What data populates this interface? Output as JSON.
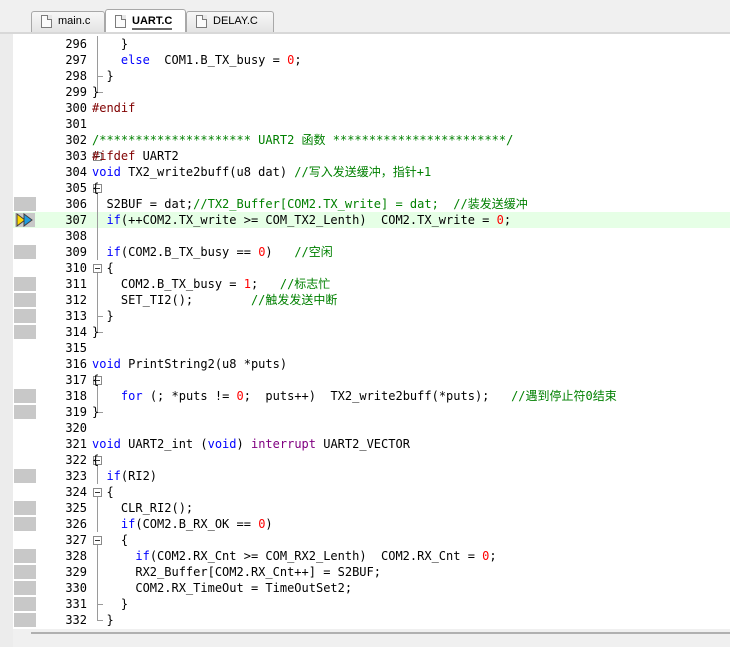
{
  "tabs": [
    {
      "label": "main.c",
      "active": false
    },
    {
      "label": "UART.C",
      "active": true
    },
    {
      "label": "DELAY.C",
      "active": false
    }
  ],
  "editor": {
    "lines": [
      {
        "num": "296",
        "code": [
          {
            "t": "    }"
          }
        ]
      },
      {
        "num": "297",
        "code": [
          {
            "t": "    "
          },
          {
            "t": "else",
            "c": "kw"
          },
          {
            "t": "  COM1.B_TX_busy = "
          },
          {
            "t": "0",
            "c": "num"
          },
          {
            "t": ";"
          }
        ]
      },
      {
        "num": "298",
        "code": [
          {
            "t": "  }"
          }
        ]
      },
      {
        "num": "299",
        "code": [
          {
            "t": "}"
          }
        ]
      },
      {
        "num": "300",
        "code": [
          {
            "t": "#endif",
            "c": "pp"
          }
        ]
      },
      {
        "num": "301",
        "code": []
      },
      {
        "num": "302",
        "code": [
          {
            "t": "/********************* UART2 函数 ************************/",
            "c": "cm"
          }
        ]
      },
      {
        "num": "303",
        "code": [
          {
            "t": "#ifdef",
            "c": "pp"
          },
          {
            "t": " UART2"
          }
        ]
      },
      {
        "num": "304",
        "code": [
          {
            "t": "void",
            "c": "kw"
          },
          {
            "t": " TX2_write2buff(u8 dat) "
          },
          {
            "t": "//写入发送缓冲，指针+1",
            "c": "cm"
          }
        ]
      },
      {
        "num": "305",
        "code": [
          {
            "t": "{"
          }
        ]
      },
      {
        "num": "306",
        "code": [
          {
            "t": "  S2BUF = dat;"
          },
          {
            "t": "//TX2_Buffer[COM2.TX_write] = dat;  //装发送缓冲",
            "c": "cm"
          }
        ]
      },
      {
        "num": "307",
        "code": [
          {
            "t": "  "
          },
          {
            "t": "if",
            "c": "kw"
          },
          {
            "t": "(++COM2.TX_write >= COM_TX2_Lenth)  COM2.TX_write = "
          },
          {
            "t": "0",
            "c": "num"
          },
          {
            "t": ";"
          }
        ]
      },
      {
        "num": "308",
        "code": []
      },
      {
        "num": "309",
        "code": [
          {
            "t": "  "
          },
          {
            "t": "if",
            "c": "kw"
          },
          {
            "t": "(COM2.B_TX_busy == "
          },
          {
            "t": "0",
            "c": "num"
          },
          {
            "t": ")   "
          },
          {
            "t": "//空闲",
            "c": "cm"
          }
        ]
      },
      {
        "num": "310",
        "code": [
          {
            "t": "  {"
          }
        ]
      },
      {
        "num": "311",
        "code": [
          {
            "t": "    COM2.B_TX_busy = "
          },
          {
            "t": "1",
            "c": "num"
          },
          {
            "t": ";   "
          },
          {
            "t": "//标志忙",
            "c": "cm"
          }
        ]
      },
      {
        "num": "312",
        "code": [
          {
            "t": "    SET_TI2();        "
          },
          {
            "t": "//触发发送中断",
            "c": "cm"
          }
        ]
      },
      {
        "num": "313",
        "code": [
          {
            "t": "  }"
          }
        ]
      },
      {
        "num": "314",
        "code": [
          {
            "t": "}"
          }
        ]
      },
      {
        "num": "315",
        "code": []
      },
      {
        "num": "316",
        "code": [
          {
            "t": "void",
            "c": "kw"
          },
          {
            "t": " PrintString2(u8 *puts)"
          }
        ]
      },
      {
        "num": "317",
        "code": [
          {
            "t": "{"
          }
        ]
      },
      {
        "num": "318",
        "code": [
          {
            "t": "    "
          },
          {
            "t": "for",
            "c": "kw"
          },
          {
            "t": " (; *puts != "
          },
          {
            "t": "0",
            "c": "num"
          },
          {
            "t": ";  puts++)  TX2_write2buff(*puts);   "
          },
          {
            "t": "//遇到停止符0结束",
            "c": "cm"
          }
        ]
      },
      {
        "num": "319",
        "code": [
          {
            "t": "}"
          }
        ]
      },
      {
        "num": "320",
        "code": []
      },
      {
        "num": "321",
        "code": [
          {
            "t": "void",
            "c": "kw"
          },
          {
            "t": " UART2_int ("
          },
          {
            "t": "void",
            "c": "kw"
          },
          {
            "t": ") "
          },
          {
            "t": "interrupt",
            "c": "ir"
          },
          {
            "t": " UART2_VECTOR"
          }
        ]
      },
      {
        "num": "322",
        "code": [
          {
            "t": "{"
          }
        ]
      },
      {
        "num": "323",
        "code": [
          {
            "t": "  "
          },
          {
            "t": "if",
            "c": "kw"
          },
          {
            "t": "(RI2)"
          }
        ]
      },
      {
        "num": "324",
        "code": [
          {
            "t": "  {"
          }
        ]
      },
      {
        "num": "325",
        "code": [
          {
            "t": "    CLR_RI2();"
          }
        ]
      },
      {
        "num": "326",
        "code": [
          {
            "t": "    "
          },
          {
            "t": "if",
            "c": "kw"
          },
          {
            "t": "(COM2.B_RX_OK == "
          },
          {
            "t": "0",
            "c": "num"
          },
          {
            "t": ")"
          }
        ]
      },
      {
        "num": "327",
        "code": [
          {
            "t": "    {"
          }
        ]
      },
      {
        "num": "328",
        "code": [
          {
            "t": "      "
          },
          {
            "t": "if",
            "c": "kw"
          },
          {
            "t": "(COM2.RX_Cnt >= COM_RX2_Lenth)  COM2.RX_Cnt = "
          },
          {
            "t": "0",
            "c": "num"
          },
          {
            "t": ";"
          }
        ]
      },
      {
        "num": "329",
        "code": [
          {
            "t": "      RX2_Buffer[COM2.RX_Cnt++] = S2BUF;"
          }
        ]
      },
      {
        "num": "330",
        "code": [
          {
            "t": "      COM2.RX_TimeOut = TimeOutSet2;"
          }
        ]
      },
      {
        "num": "331",
        "code": [
          {
            "t": "    }"
          }
        ]
      },
      {
        "num": "332",
        "code": [
          {
            "t": "  }"
          }
        ]
      }
    ]
  },
  "colors": {
    "keyword": "#0000ff",
    "preprocessor": "#800000",
    "number": "#ff0000",
    "comment": "#008000",
    "interrupt_keyword": "#800080",
    "current_line": "#e6ffe6"
  }
}
